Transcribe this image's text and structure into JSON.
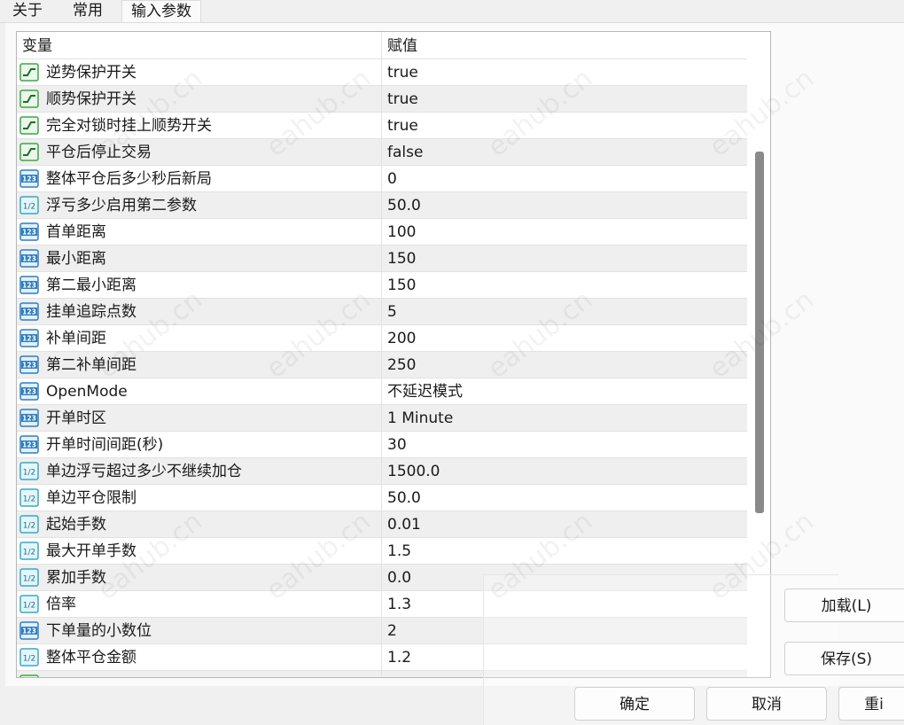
{
  "tabs": [
    {
      "label": "关于"
    },
    {
      "label": "常用"
    },
    {
      "label": "输入参数"
    }
  ],
  "table": {
    "col_name": "变量",
    "col_value": "赋值",
    "rows": [
      {
        "name": "逆势保护开关",
        "value": "true",
        "icon": "toggle-icon"
      },
      {
        "name": "顺势保护开关",
        "value": "true",
        "icon": "toggle-icon"
      },
      {
        "name": "完全对锁时挂上顺势开关",
        "value": "true",
        "icon": "toggle-icon"
      },
      {
        "name": "平仓后停止交易",
        "value": "false",
        "icon": "toggle-icon"
      },
      {
        "name": "整体平仓后多少秒后新局",
        "value": "0",
        "icon": "integer-icon"
      },
      {
        "name": "浮亏多少启用第二参数",
        "value": "50.0",
        "icon": "double-icon"
      },
      {
        "name": "首单距离",
        "value": "100",
        "icon": "integer-icon"
      },
      {
        "name": "最小距离",
        "value": "150",
        "icon": "integer-icon"
      },
      {
        "name": "第二最小距离",
        "value": "150",
        "icon": "integer-icon"
      },
      {
        "name": "挂单追踪点数",
        "value": "5",
        "icon": "integer-icon"
      },
      {
        "name": "补单间距",
        "value": "200",
        "icon": "integer-icon"
      },
      {
        "name": "第二补单间距",
        "value": "250",
        "icon": "integer-icon"
      },
      {
        "name": "OpenMode",
        "value": "不延迟模式",
        "icon": "integer-icon"
      },
      {
        "name": "开单时区",
        "value": "1 Minute",
        "icon": "integer-icon"
      },
      {
        "name": "开单时间间距(秒)",
        "value": "30",
        "icon": "integer-icon"
      },
      {
        "name": "单边浮亏超过多少不继续加仓",
        "value": "1500.0",
        "icon": "double-icon"
      },
      {
        "name": "单边平仓限制",
        "value": "50.0",
        "icon": "double-icon"
      },
      {
        "name": "起始手数",
        "value": "0.01",
        "icon": "double-icon"
      },
      {
        "name": "最大开单手数",
        "value": "1.5",
        "icon": "double-icon"
      },
      {
        "name": "累加手数",
        "value": "0.0",
        "icon": "double-icon"
      },
      {
        "name": "倍率",
        "value": "1.3",
        "icon": "double-icon"
      },
      {
        "name": "下单量的小数位",
        "value": "2",
        "icon": "integer-icon"
      },
      {
        "name": "整体平仓金额",
        "value": "1.2",
        "icon": "double-icon"
      }
    ]
  },
  "buttons": {
    "load": "加载(L)",
    "save": "保存(S)",
    "ok": "确定",
    "cancel": "取消",
    "reset": "重i"
  },
  "watermark": "eahub.cn",
  "colors": {
    "toggle_icon": "#3aa845",
    "integer_icon": "#2f7fbf",
    "double_icon": "#37a8c8"
  }
}
